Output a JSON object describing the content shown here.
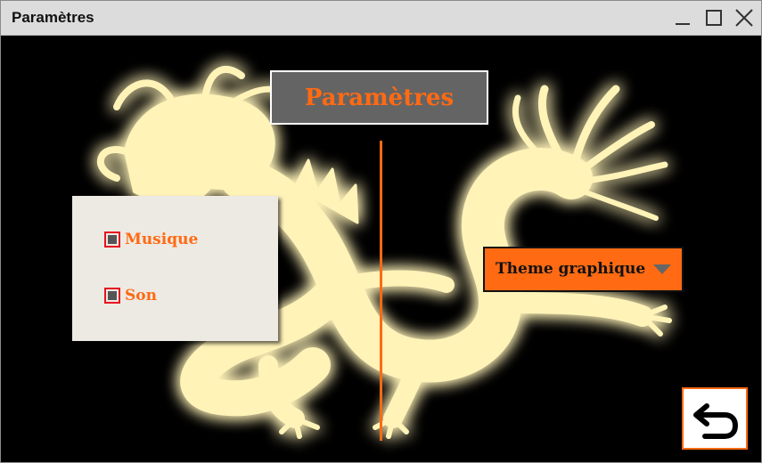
{
  "window": {
    "title": "Paramètres",
    "controls": [
      "minimize-icon",
      "maximize-icon",
      "close-icon"
    ]
  },
  "header": {
    "title": "Paramètres"
  },
  "options": {
    "items": [
      {
        "label": "Musique",
        "checked": true
      },
      {
        "label": "Son",
        "checked": true
      }
    ]
  },
  "theme_select": {
    "label": "Theme graphique",
    "icon": "chevron-down-icon"
  },
  "back_button": {
    "icon": "return-arrow-icon"
  },
  "colors": {
    "accent": "#ff6a13",
    "title_box_bg": "#646464",
    "panel_bg": "#edeae4",
    "checkbox_border": "#e4141e",
    "dragon_glow": "#fff3b8",
    "background": "#000000"
  }
}
